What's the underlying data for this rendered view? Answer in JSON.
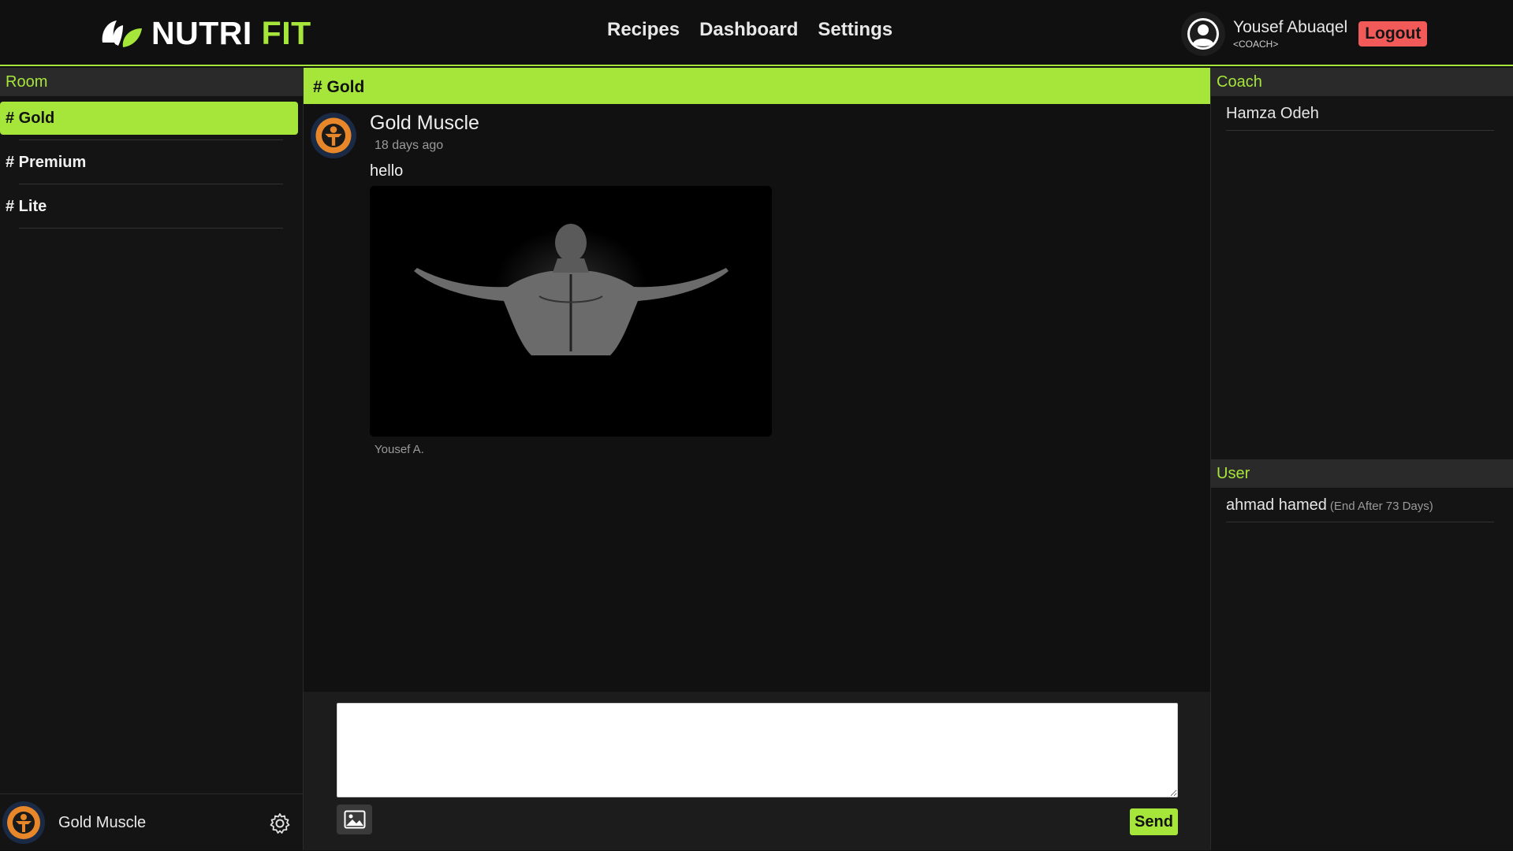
{
  "brand": {
    "part1": "NUTRI",
    "part2": "FIT",
    "accent": "#a6e63a"
  },
  "nav": {
    "items": [
      "Recipes",
      "Dashboard",
      "Settings"
    ]
  },
  "user": {
    "name": "Yousef Abuaqel",
    "role": "<COACH>",
    "logout_label": "Logout"
  },
  "left_panel": {
    "title": "Room",
    "rooms": [
      "# Gold",
      "# Premium",
      "# Lite"
    ],
    "active_room": "# Gold",
    "profile_name": "Gold Muscle"
  },
  "channel": {
    "title": "# Gold",
    "message": {
      "author": "Gold Muscle",
      "time": "18 days ago",
      "text": "hello",
      "image_caption": "Yousef A."
    }
  },
  "composer": {
    "placeholder": "",
    "send_label": "Send"
  },
  "right_panel": {
    "coach_title": "Coach",
    "coaches": [
      "Hamza Odeh"
    ],
    "user_title": "User",
    "users": [
      {
        "name": "ahmad hamed",
        "note": "(End After 73 Days)"
      }
    ]
  },
  "icons": {
    "logo": "leaf-logo-icon",
    "avatar": "user-avatar-icon",
    "room_avatar": "fitness-badge-icon",
    "image_upload": "image-icon",
    "settings": "gear-icon"
  }
}
